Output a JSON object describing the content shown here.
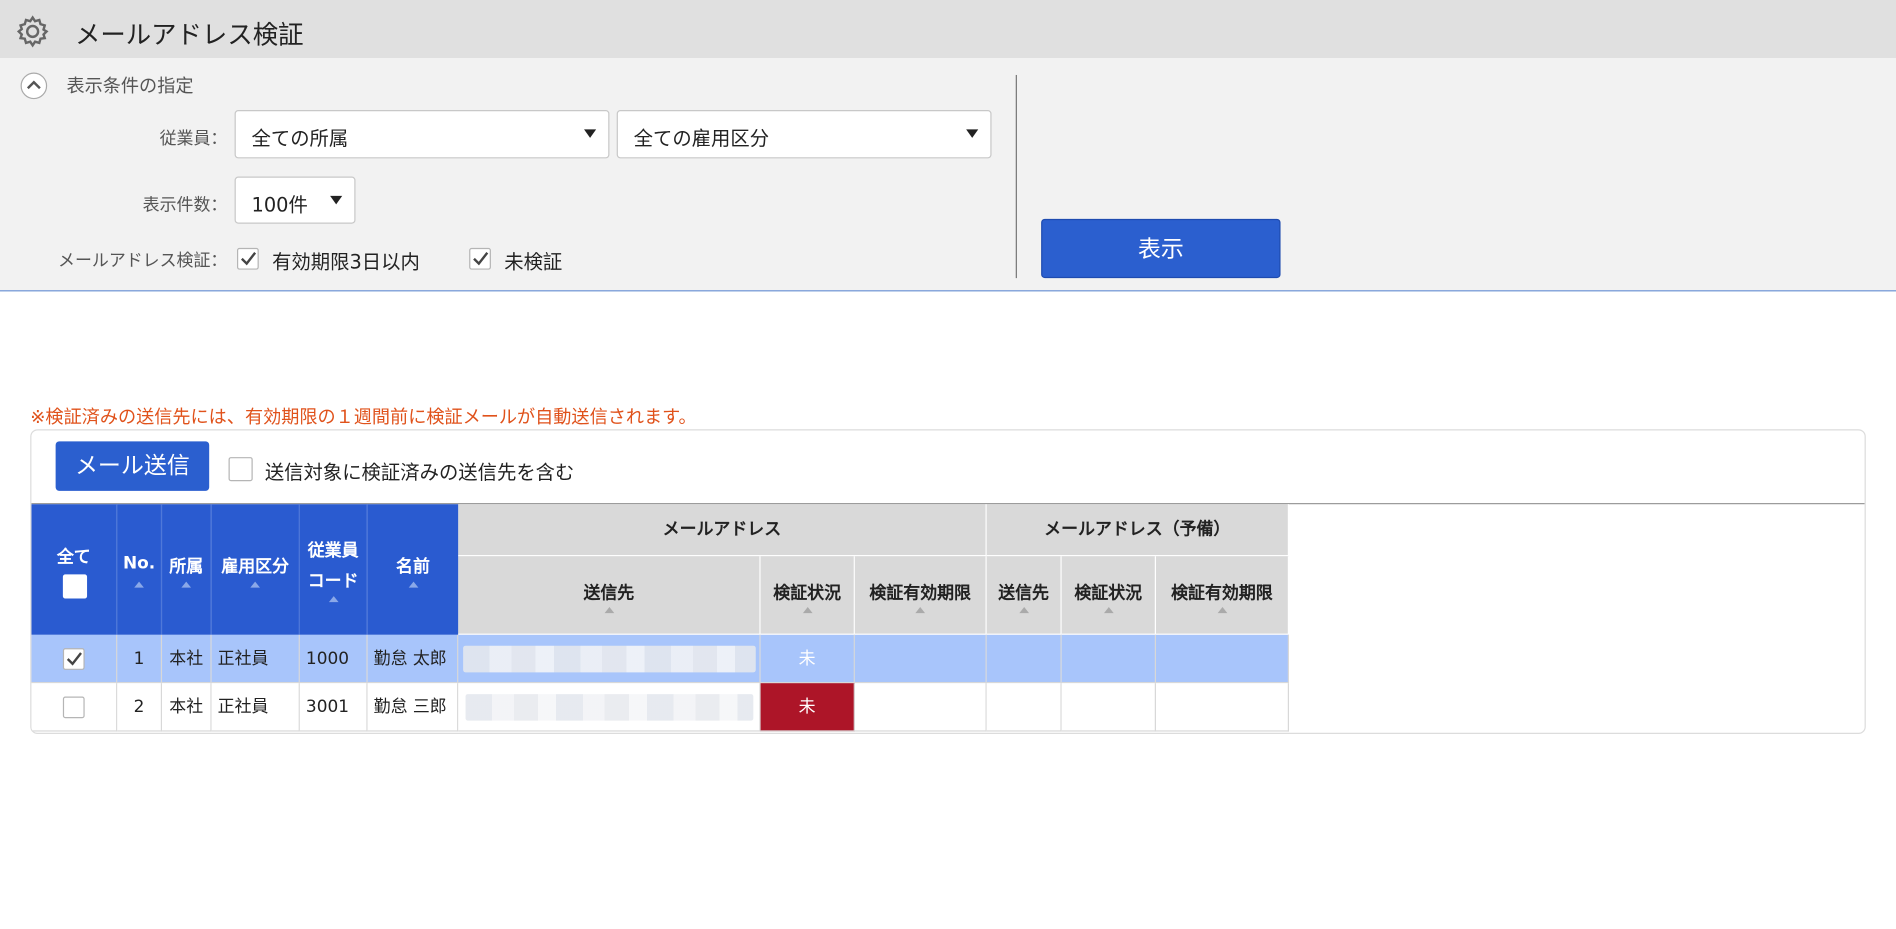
{
  "header": {
    "title": "メールアドレス検証",
    "icon": "gear-icon"
  },
  "filter": {
    "section_title": "表示条件の指定",
    "employee_label": "従業員：",
    "affiliation_select": "全ての所属",
    "employment_type_select": "全ての雇用区分",
    "count_label": "表示件数：",
    "count_select": "100件",
    "verify_label": "メールアドレス検証：",
    "checkboxes": [
      {
        "label": "有効期限3日以内",
        "checked": true
      },
      {
        "label": "未検証",
        "checked": true
      }
    ],
    "show_button": "表示"
  },
  "notice": "※検証済みの送信先には、有効期限の１週間前に検証メールが自動送信されます。",
  "toolbar": {
    "send_button": "メール送信",
    "include_verified_label": "送信対象に検証済みの送信先を含む",
    "include_verified_checked": false
  },
  "table": {
    "headers": {
      "all": "全て",
      "no": "No.",
      "affiliation": "所属",
      "employment_type": "雇用区分",
      "employee_code_line1": "従業員",
      "employee_code_line2": "コード",
      "name": "名前",
      "email_group": "メールアドレス",
      "email_backup_group": "メールアドレス（予備）",
      "recipient": "送信先",
      "status": "検証状況",
      "expiry": "検証有効期限"
    },
    "rows": [
      {
        "checked": true,
        "no": "1",
        "affiliation": "本社",
        "employment_type": "正社員",
        "code": "1000",
        "name": "勤怠 太郎",
        "status": "未",
        "status_color": "#a8c5fb"
      },
      {
        "checked": false,
        "no": "2",
        "affiliation": "本社",
        "employment_type": "正社員",
        "code": "3001",
        "name": "勤怠 三郎",
        "status": "未",
        "status_color": "#ad1528"
      }
    ]
  },
  "colors": {
    "primary": "#2b5fcf",
    "header_blue": "#2a5bd0",
    "selected_row": "#a8c5fb",
    "notice": "#e0521b",
    "unverified_red": "#ad1528"
  }
}
